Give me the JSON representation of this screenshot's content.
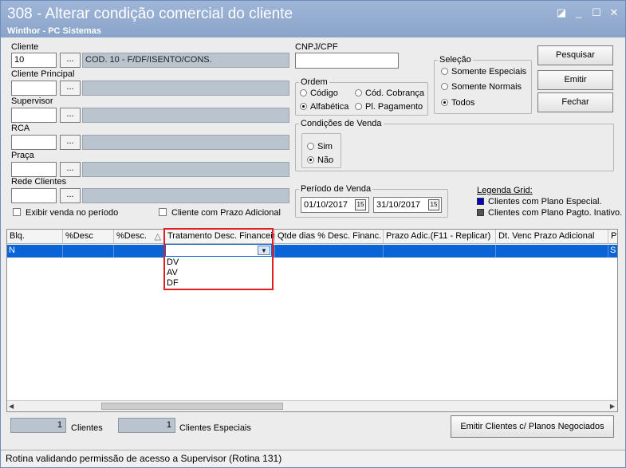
{
  "window": {
    "title": "308 - Alterar condição comercial do cliente",
    "subtitle": "Winthor - PC Sistemas"
  },
  "form": {
    "cliente_label": "Cliente",
    "cliente_code": "10",
    "cliente_desc": "COD. 10 - F/DF/ISENTO/CONS.",
    "cliente_principal_label": "Cliente Principal",
    "supervisor_label": "Supervisor",
    "rca_label": "RCA",
    "praca_label": "Praça",
    "rede_label": "Rede Clientes",
    "dots": "...",
    "cnpj_label": "CNPJ/CPF",
    "exibir_venda": "Exibir venda no período",
    "prazo_adicional": "Cliente com Prazo Adicional"
  },
  "ordem": {
    "label": "Ordem",
    "codigo": "Código",
    "cod_cobranca": "Cód. Cobrança",
    "alfabetica": "Alfabética",
    "pl_pagamento": "Pl. Pagamento"
  },
  "selecao": {
    "label": "Seleção",
    "especiais": "Somente Especiais",
    "normais": "Somente Normais",
    "todos": "Todos"
  },
  "condicoes": {
    "label": "Condições de Venda",
    "sim": "Sim",
    "nao": "Não"
  },
  "periodo": {
    "label": "Período de Venda",
    "inicio": "01/10/2017",
    "fim": "31/10/2017",
    "cal": "15"
  },
  "legenda": {
    "label": "Legenda Grid:",
    "especial": "Clientes com Plano Especial.",
    "inativo": "Clientes com Plano Pagto. Inativo.",
    "color_especial": "#0000cc",
    "color_inativo": "#555555"
  },
  "buttons": {
    "pesquisar": "Pesquisar",
    "emitir": "Emitir",
    "fechar": "Fechar",
    "emitir_planos": "Emitir Clientes c/ Planos Negociados"
  },
  "grid": {
    "headers": [
      "Blq.",
      "%Desc",
      "%Desc.",
      "Tratamento Desc. Financeir",
      "Qtde dias % Desc. Financ.",
      "Prazo Adic.(F11 - Replicar)",
      "Dt. Venc Prazo Adicional",
      "Pl"
    ],
    "sort_icon": "△",
    "row": [
      "N",
      "",
      "",
      "",
      "",
      "",
      "",
      "S"
    ],
    "dropdown_options": [
      "DV",
      "AV",
      "DF"
    ]
  },
  "counts": {
    "clientes_value": "1",
    "clientes_label": "Clientes",
    "especiais_value": "1",
    "especiais_label": "Clientes Especiais"
  },
  "status": "Rotina validando permissão de acesso a Supervisor (Rotina 131)"
}
